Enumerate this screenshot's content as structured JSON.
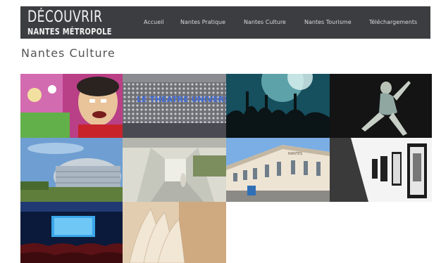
{
  "header": {
    "logo_line1": "DÉCOUVRIR",
    "logo_line2": "NANTES MÉTROPOLE",
    "nav": [
      {
        "label": "Accueil"
      },
      {
        "label": "Nantes Pratique"
      },
      {
        "label": "Nantes Culture"
      },
      {
        "label": "Nantes Tourisme"
      },
      {
        "label": "Téléchargements"
      }
    ]
  },
  "main": {
    "title": "Nantes Culture",
    "gallery": [
      {
        "subject": "carnival-figure",
        "caption": ""
      },
      {
        "subject": "theatre-facade",
        "caption": "LE THEATRE UNIVERSITAIRE"
      },
      {
        "subject": "concert-crowd",
        "caption": ""
      },
      {
        "subject": "dancer",
        "caption": ""
      },
      {
        "subject": "modern-building",
        "caption": ""
      },
      {
        "subject": "museum-hall",
        "caption": ""
      },
      {
        "subject": "historic-building",
        "caption": "NANTES"
      },
      {
        "subject": "gallery-frames",
        "caption": ""
      },
      {
        "subject": "cinema-screen",
        "caption": ""
      },
      {
        "subject": "open-book",
        "caption": ""
      }
    ]
  },
  "colors": {
    "header_bg": "#3b3d40",
    "header_text": "#f2f2f2",
    "nav_text": "#d9d9d9",
    "title_text": "#555555"
  }
}
